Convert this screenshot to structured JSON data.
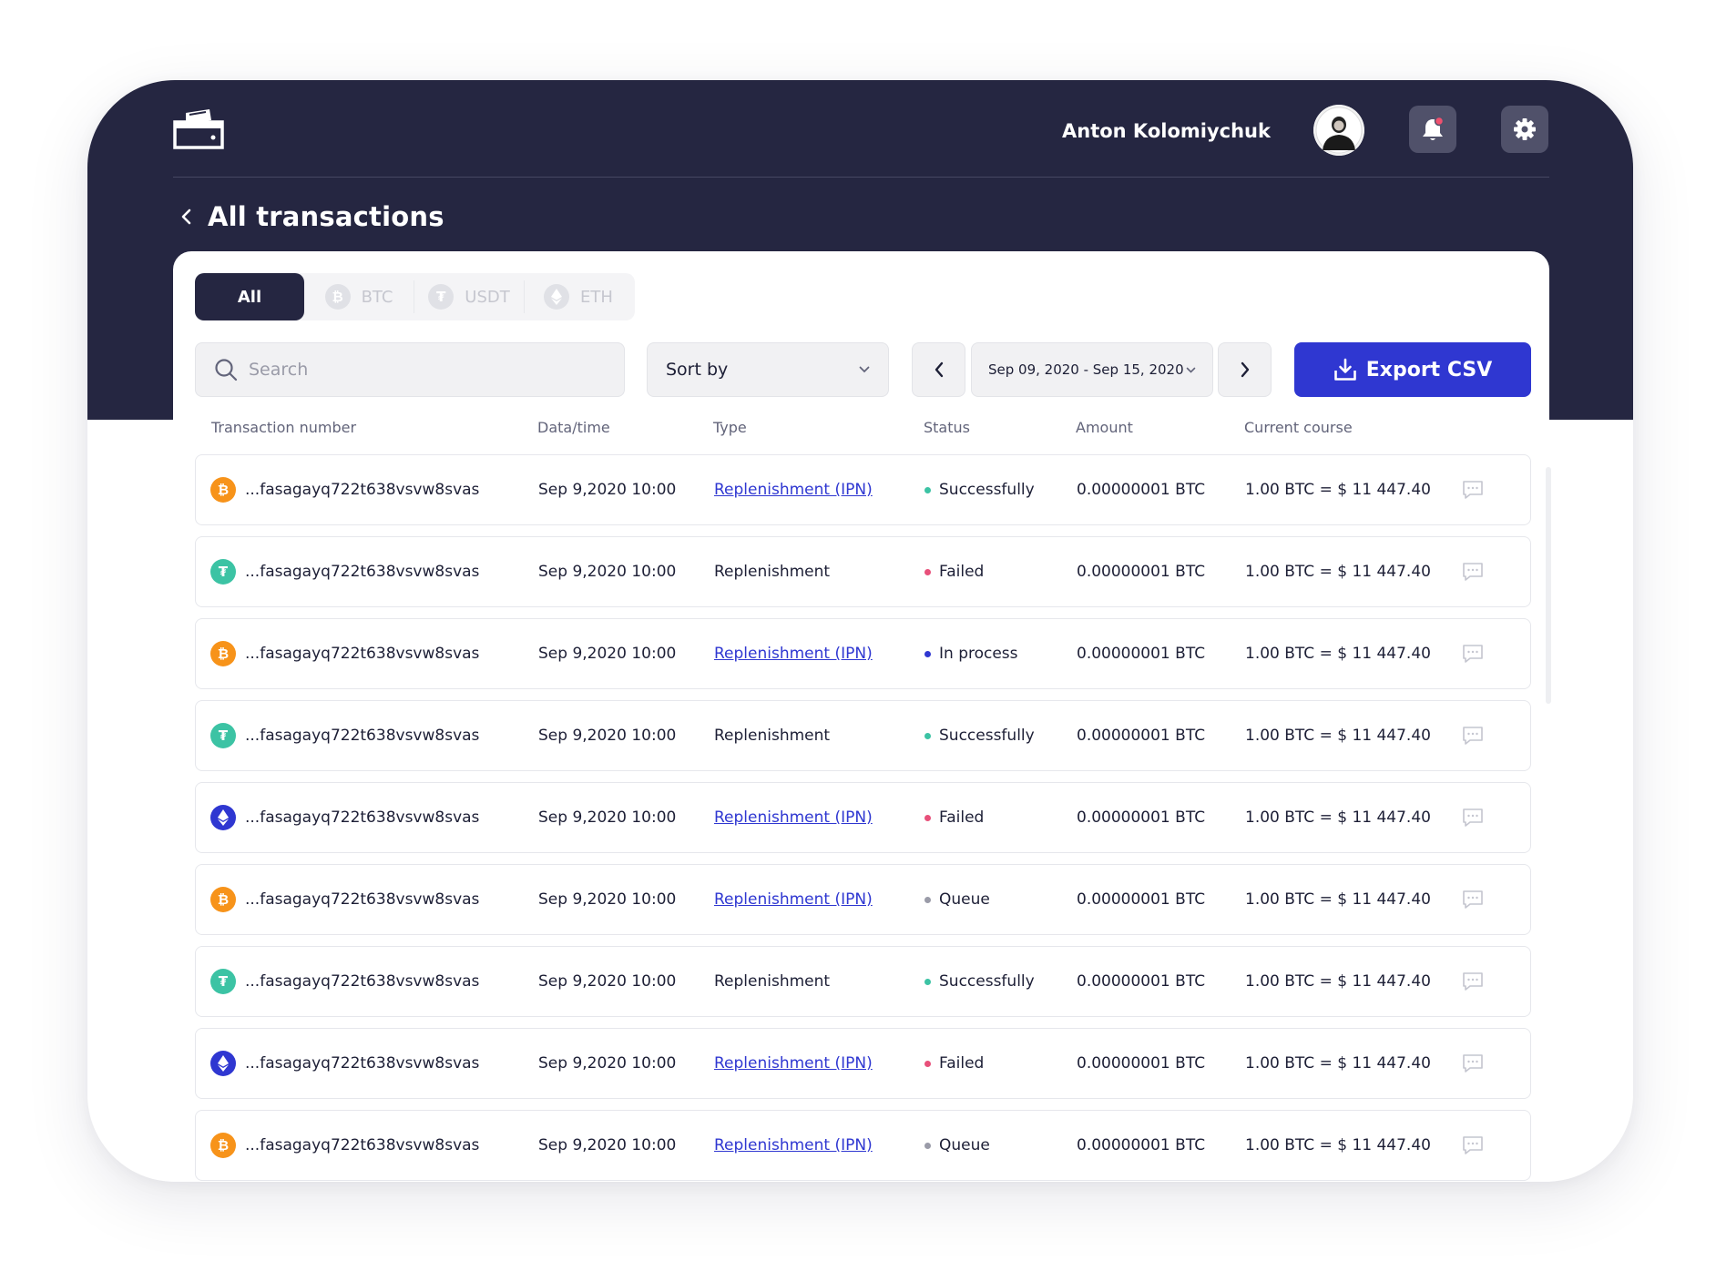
{
  "header": {
    "user_name": "Anton Kolomiychuk",
    "page_title": "All transactions"
  },
  "tabs": [
    {
      "label": "All",
      "icon": "all",
      "active": true
    },
    {
      "label": "BTC",
      "icon": "bitcoin-icon",
      "active": false
    },
    {
      "label": "USDT",
      "icon": "tether-icon",
      "active": false
    },
    {
      "label": "ETH",
      "icon": "ethereum-icon",
      "active": false
    }
  ],
  "toolbar": {
    "search_placeholder": "Search",
    "sort_label": "Sort by",
    "date_range": "Sep 09, 2020 - Sep 15, 2020",
    "export_label": "Export CSV"
  },
  "columns": {
    "number": "Transaction number",
    "datetime": "Data/time",
    "type": "Type",
    "status": "Status",
    "amount": "Amount",
    "course": "Current course"
  },
  "colors": {
    "header_bg": "#252641",
    "accent": "#2f37d1",
    "btc": "#f7931a",
    "usdt": "#3cc3a4",
    "eth": "#2f37d1",
    "status_success": "#3cc3a4",
    "status_failed": "#e8507a",
    "status_process": "#2f37d1",
    "status_queue": "#9a9ba8"
  },
  "transactions": [
    {
      "coin": "btc",
      "number": "...fasagayq722t638vsvw8svas",
      "datetime": "Sep 9,2020 10:00",
      "type": "Replenishment (IPN)",
      "type_link": true,
      "status": "Successfully",
      "status_kind": "success",
      "amount": "0.00000001 BTC",
      "course": "1.00 BTC = $ 11 447.40"
    },
    {
      "coin": "usdt",
      "number": "...fasagayq722t638vsvw8svas",
      "datetime": "Sep 9,2020 10:00",
      "type": "Replenishment",
      "type_link": false,
      "status": "Failed",
      "status_kind": "failed",
      "amount": "0.00000001 BTC",
      "course": "1.00 BTC = $ 11 447.40"
    },
    {
      "coin": "btc",
      "number": "...fasagayq722t638vsvw8svas",
      "datetime": "Sep 9,2020 10:00",
      "type": "Replenishment (IPN)",
      "type_link": true,
      "status": "In process",
      "status_kind": "process",
      "amount": "0.00000001 BTC",
      "course": "1.00 BTC = $ 11 447.40"
    },
    {
      "coin": "usdt",
      "number": "...fasagayq722t638vsvw8svas",
      "datetime": "Sep 9,2020 10:00",
      "type": "Replenishment",
      "type_link": false,
      "status": "Successfully",
      "status_kind": "success",
      "amount": "0.00000001 BTC",
      "course": "1.00 BTC = $ 11 447.40"
    },
    {
      "coin": "eth",
      "number": "...fasagayq722t638vsvw8svas",
      "datetime": "Sep 9,2020 10:00",
      "type": "Replenishment (IPN)",
      "type_link": true,
      "status": "Failed",
      "status_kind": "failed",
      "amount": "0.00000001 BTC",
      "course": "1.00 BTC = $ 11 447.40"
    },
    {
      "coin": "btc",
      "number": "...fasagayq722t638vsvw8svas",
      "datetime": "Sep 9,2020 10:00",
      "type": "Replenishment (IPN)",
      "type_link": true,
      "status": "Queue",
      "status_kind": "queue",
      "amount": "0.00000001 BTC",
      "course": "1.00 BTC = $ 11 447.40"
    },
    {
      "coin": "usdt",
      "number": "...fasagayq722t638vsvw8svas",
      "datetime": "Sep 9,2020 10:00",
      "type": "Replenishment",
      "type_link": false,
      "status": "Successfully",
      "status_kind": "success",
      "amount": "0.00000001 BTC",
      "course": "1.00 BTC = $ 11 447.40"
    },
    {
      "coin": "eth",
      "number": "...fasagayq722t638vsvw8svas",
      "datetime": "Sep 9,2020 10:00",
      "type": "Replenishment (IPN)",
      "type_link": true,
      "status": "Failed",
      "status_kind": "failed",
      "amount": "0.00000001 BTC",
      "course": "1.00 BTC = $ 11 447.40"
    },
    {
      "coin": "btc",
      "number": "...fasagayq722t638vsvw8svas",
      "datetime": "Sep 9,2020 10:00",
      "type": "Replenishment (IPN)",
      "type_link": true,
      "status": "Queue",
      "status_kind": "queue",
      "amount": "0.00000001 BTC",
      "course": "1.00 BTC = $ 11 447.40"
    }
  ]
}
